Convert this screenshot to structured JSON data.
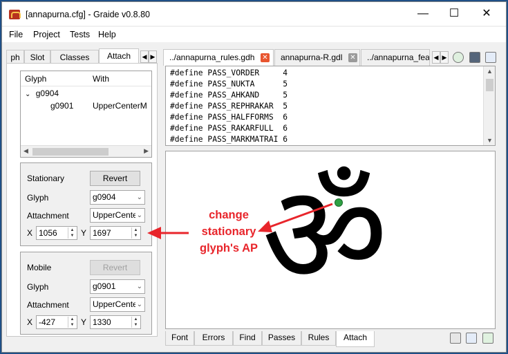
{
  "window": {
    "title": "[annapurna.cfg] - Graide v0.8.80",
    "minimize": "—",
    "maximize": "☐",
    "close": "✕"
  },
  "menu": [
    "File",
    "Project",
    "Tests",
    "Help"
  ],
  "left_tabs": [
    "ph",
    "Slot",
    "Classes",
    "Attach"
  ],
  "tree": {
    "columns": [
      "Glyph",
      "With"
    ],
    "parent": "g0904",
    "child_glyph": "g0901",
    "child_with": "UpperCenterM"
  },
  "stationary": {
    "title": "Stationary",
    "revert": "Revert",
    "glyph_label": "Glyph",
    "glyph": "g0904",
    "attachment_label": "Attachment",
    "attachment": "UpperCente",
    "x_label": "X",
    "x": "1056",
    "y_label": "Y",
    "y": "1697"
  },
  "mobile": {
    "title": "Mobile",
    "revert": "Revert",
    "glyph_label": "Glyph",
    "glyph": "g0901",
    "attachment_label": "Attachment",
    "attachment": "UpperCente",
    "x_label": "X",
    "x": "-427",
    "y_label": "Y",
    "y": "1330"
  },
  "doc_tabs": [
    "../annapurna_rules.gdh",
    "annapurna-R.gdl",
    "../annapurna_fea"
  ],
  "code_lines": [
    "#define PASS_VORDER     4",
    "#define PASS_NUKTA      5",
    "#define PASS_AHKAND     5",
    "#define PASS_REPHRAKAR  5",
    "#define PASS_HALFFORMS  6",
    "#define PASS_RAKARFULL  6",
    "#define PASS_MARKMATRAI 6"
  ],
  "glyph_display": "ॐ",
  "annotation": [
    "change",
    "stationary",
    "glyph's AP"
  ],
  "bottom_tabs": [
    "Font",
    "Errors",
    "Find",
    "Passes",
    "Rules",
    "Attach"
  ],
  "colors": {
    "annotation": "#e8252b",
    "ap_dot": "#2ea043",
    "titlebar_bg": "#ffffff",
    "desktop": "#1f4f86"
  },
  "icons": [
    "app-icon",
    "close-tab-icon",
    "verify-icon",
    "save-icon",
    "copy-icon",
    "wrench-icon",
    "add-icon"
  ]
}
